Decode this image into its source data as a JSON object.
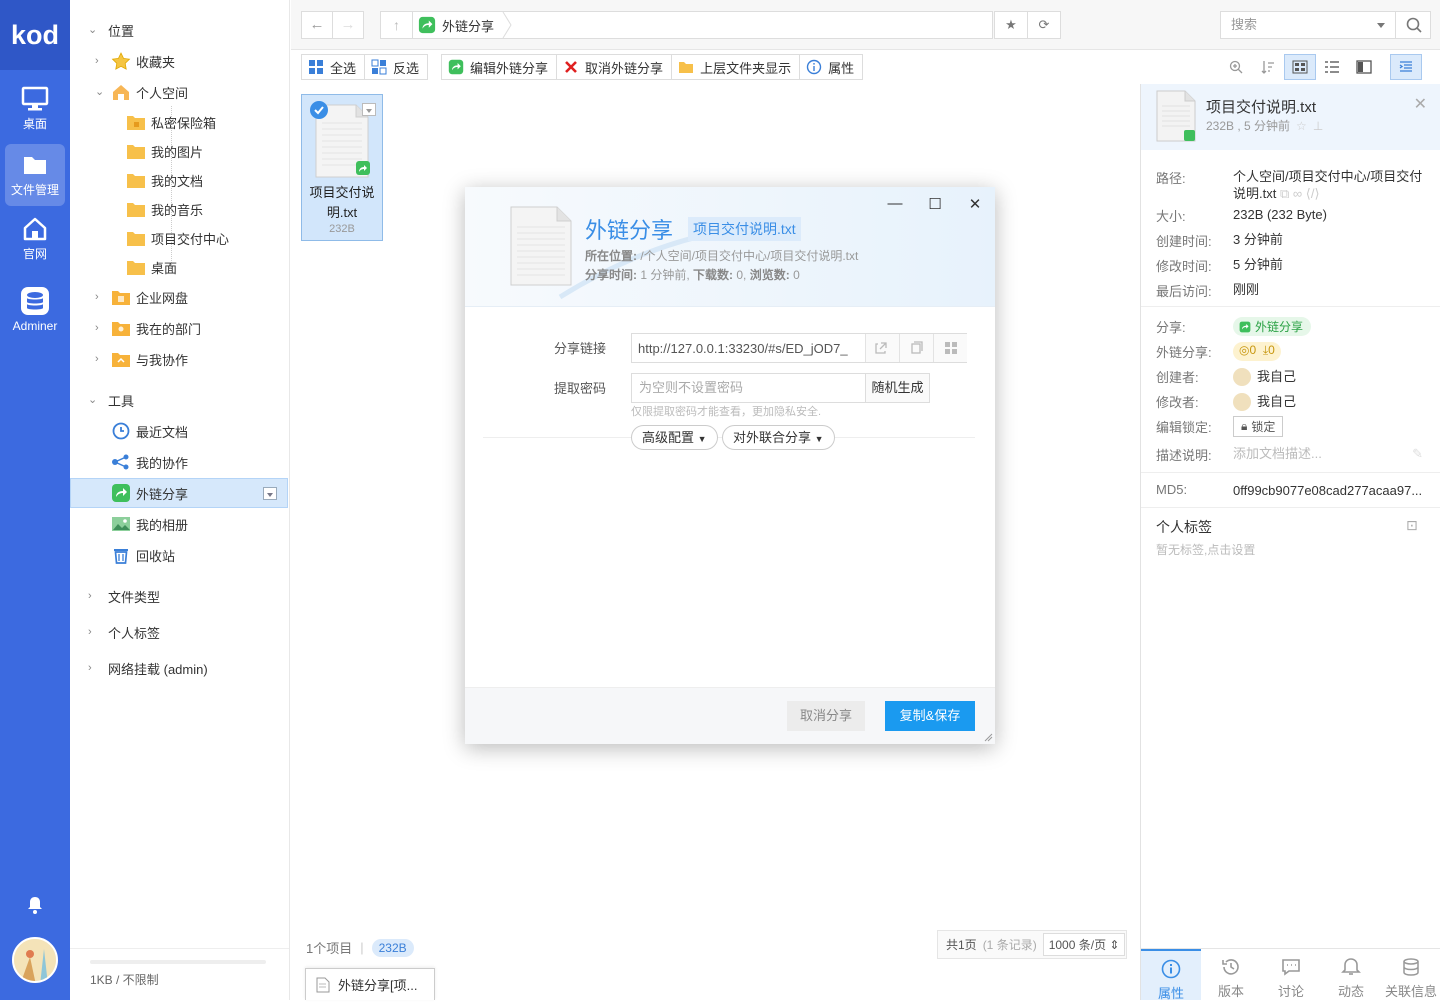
{
  "app": {
    "logo": "kod"
  },
  "rail": {
    "items": [
      {
        "label": "桌面",
        "icon": "monitor-icon"
      },
      {
        "label": "文件管理",
        "icon": "folder-icon",
        "active": true
      },
      {
        "label": "官网",
        "icon": "home-icon"
      },
      {
        "label": "Adminer",
        "icon": "database-icon"
      }
    ]
  },
  "sidebar": {
    "location_header": "位置",
    "favorites": "收藏夹",
    "personal_space": "个人空间",
    "personal_children": [
      "私密保险箱",
      "我的图片",
      "我的文档",
      "我的音乐",
      "项目交付中心",
      "桌面"
    ],
    "enterprise_disk": "企业网盘",
    "my_department": "我在的部门",
    "collab_with_me": "与我协作",
    "tools_header": "工具",
    "tools": [
      "最近文档",
      "我的协作",
      "外链分享",
      "我的相册",
      "回收站"
    ],
    "file_types": "文件类型",
    "personal_tags": "个人标签",
    "network_mount": "网络挂载 (admin)",
    "quota": "1KB / 不限制"
  },
  "address": {
    "crumb": "外链分享",
    "search_placeholder": "搜索"
  },
  "toolbar": {
    "select_all": "全选",
    "invert": "反选",
    "edit_share": "编辑外链分享",
    "cancel_share": "取消外链分享",
    "parent_display": "上层文件夹显示",
    "properties": "属性"
  },
  "file": {
    "name": "项目交付说明.txt",
    "name_line1": "项目交付说",
    "name_line2": "明.txt",
    "size": "232B"
  },
  "status": {
    "count": "1个项目",
    "size": "232B",
    "pages": "共1页",
    "records": "(1 条记录)",
    "per_page": "1000 条/页"
  },
  "taskbar": {
    "label": "外链分享[项..."
  },
  "dialog": {
    "title": "外链分享",
    "file_name": "项目交付说明.txt",
    "location_label": "所在位置:",
    "location_value": "/个人空间/项目交付中心/项目交付说明.txt",
    "share_time_label": "分享时间:",
    "share_time_value": "1 分钟前,",
    "downloads_label": "下载数:",
    "downloads_value": "0,",
    "views_label": "浏览数:",
    "views_value": "0",
    "share_link_label": "分享链接",
    "share_link_value": "http://127.0.0.1:33230/#s/ED_jOD7_",
    "password_label": "提取密码",
    "password_placeholder": "为空则不设置密码",
    "random_gen": "随机生成",
    "password_hint": "仅限提取密码才能查看，更加隐私安全.",
    "advanced": "高级配置",
    "federated": "对外联合分享",
    "cancel_button": "取消分享",
    "save_button": "复制&保存"
  },
  "panel": {
    "title": "项目交付说明.txt",
    "subtitle": "232B , 5 分钟前",
    "path_label": "路径:",
    "path_value": "个人空间/项目交付中心/项目交付说明.txt",
    "size_label": "大小:",
    "size_value": "232B (232 Byte)",
    "created_label": "创建时间:",
    "created_value": "3 分钟前",
    "modified_label": "修改时间:",
    "modified_value": "5 分钟前",
    "accessed_label": "最后访问:",
    "accessed_value": "刚刚",
    "share_label": "分享:",
    "share_value": "外链分享",
    "link_share_label": "外链分享:",
    "views_count": "0",
    "downloads_count": "0",
    "creator_label": "创建者:",
    "creator_value": "我自己",
    "modifier_label": "修改者:",
    "modifier_value": "我自己",
    "edit_lock_label": "编辑锁定:",
    "lock_button": "锁定",
    "desc_label": "描述说明:",
    "desc_placeholder": "添加文档描述...",
    "md5_label": "MD5:",
    "md5_value": "0ff99cb9077e08cad277acaa97...",
    "tags_header": "个人标签",
    "tags_hint": "暂无标签,点击设置",
    "tabs": [
      "属性",
      "版本",
      "讨论",
      "动态",
      "关联信息"
    ]
  },
  "colors": {
    "accent": "#3a8ee6",
    "rail": "#3c6ae0",
    "primary_button": "#1a9af0",
    "share_green": "#2aa144"
  }
}
